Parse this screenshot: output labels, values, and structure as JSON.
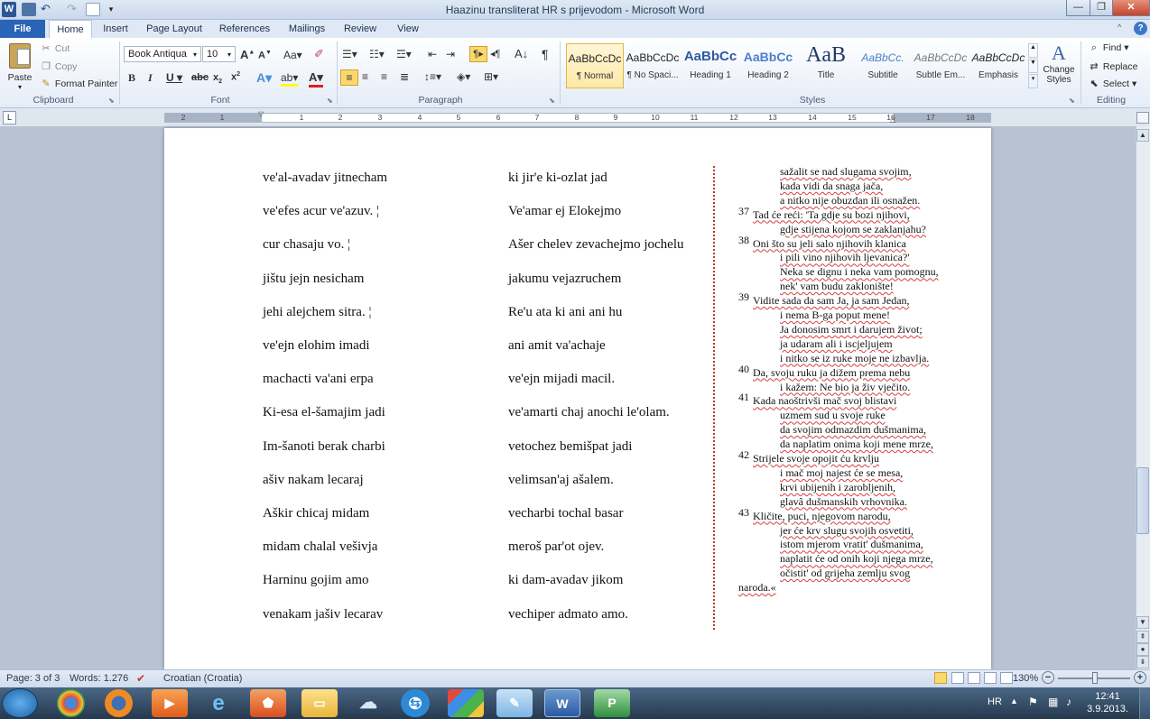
{
  "window": {
    "title": "Haazinu transliterat HR s prijevodom  -  Microsoft Word"
  },
  "tabs": [
    "File",
    "Home",
    "Insert",
    "Page Layout",
    "References",
    "Mailings",
    "Review",
    "View"
  ],
  "clipboard": {
    "paste": "Paste",
    "cut": "Cut",
    "copy": "Copy",
    "format_painter": "Format Painter",
    "label": "Clipboard"
  },
  "font": {
    "name": "Book Antiqua",
    "size": "10",
    "label": "Font"
  },
  "paragraph": {
    "label": "Paragraph"
  },
  "styles": {
    "label": "Styles",
    "items": [
      {
        "sample": "AaBbCcDc",
        "name": "¶ Normal"
      },
      {
        "sample": "AaBbCcDc",
        "name": "¶ No Spaci..."
      },
      {
        "sample": "AaBbCc",
        "name": "Heading 1"
      },
      {
        "sample": "AaBbCc",
        "name": "Heading 2"
      },
      {
        "sample": "AaB",
        "name": "Title"
      },
      {
        "sample": "AaBbCc.",
        "name": "Subtitle"
      },
      {
        "sample": "AaBbCcDc",
        "name": "Subtle Em..."
      },
      {
        "sample": "AaBbCcDc",
        "name": "Emphasis"
      }
    ],
    "change_styles": "Change Styles"
  },
  "editing": {
    "find": "Find",
    "replace": "Replace",
    "select": "Select",
    "label": "Editing"
  },
  "ruler": {
    "numbers": [
      "2",
      "1",
      "1",
      "2",
      "3",
      "4",
      "5",
      "6",
      "7",
      "8",
      "9",
      "10",
      "11",
      "12",
      "13",
      "14",
      "15",
      "16",
      "17",
      "18"
    ]
  },
  "translit": {
    "col1": [
      "ve'al-avadav jitnecham",
      "ve'efes acur ve'azuv. ¦",
      "cur chasaju vo. ¦",
      "jištu jejn nesicham",
      "jehi alejchem sitra. ¦",
      "ve'ejn elohim imadi",
      "machacti va'ani erpa",
      "Ki-esa el-šamajim jadi",
      "Im-šanoti berak charbi",
      "ašiv nakam lecaraj",
      "Aškir chicaj midam",
      "midam chalal vešivja",
      "Harninu gojim amo",
      "venakam jašiv lecarav"
    ],
    "col2": [
      "ki jir'e ki-ozlat jad",
      "Ve'amar ej Elokejmo",
      "Ašer chelev zevachejmo jochelu",
      "jakumu vejazruchem",
      "Re'u ata ki ani ani hu",
      "ani amit va'achaje",
      "ve'ejn mijadi macil.",
      "ve'amarti chaj anochi le'olam.",
      "vetochez bemišpat jadi",
      "velimsan'aj ašalem.",
      "vecharbi tochal basar",
      "meroš par'ot ojev.",
      "ki dam-avadav jikom",
      "vechiper admato amo."
    ]
  },
  "translation": [
    {
      "num": "",
      "text": "sažalit se nad slugama svojim,",
      "indent": true
    },
    {
      "num": "",
      "text": "kada vidi da snaga jača,",
      "indent": true
    },
    {
      "num": "",
      "text": "a nitko nije obuzdan ili osnažen.",
      "indent": true
    },
    {
      "num": "37",
      "text": "Tad će reći: 'Ta gdje su bozi njihovi,",
      "indent": false
    },
    {
      "num": "",
      "text": "gdje stijena kojom se zaklanjahu?",
      "indent": true
    },
    {
      "num": "38",
      "text": "Oni što su jeli salo njihovih klanica",
      "indent": false
    },
    {
      "num": "",
      "text": "i pili vino njihovih ljevanica?'",
      "indent": true
    },
    {
      "num": "",
      "text": "Neka se dignu i neka vam pomognu,",
      "indent": true
    },
    {
      "num": "",
      "text": "nek' vam budu zaklonište!",
      "indent": true
    },
    {
      "num": "39",
      "text": "Vidite sada da sam Ja, ja sam Jedan,",
      "indent": false
    },
    {
      "num": "",
      "text": "i nema B-ga poput mene!",
      "indent": true
    },
    {
      "num": "",
      "text": "Ja donosim smrt i darujem život;",
      "indent": true
    },
    {
      "num": "",
      "text": "ja udaram ali i iscjeljujem",
      "indent": true
    },
    {
      "num": "",
      "text": "i nitko se iz ruke moje ne izbavlja.",
      "indent": true
    },
    {
      "num": "40",
      "text": "Da, svoju ruku ja dižem prema nebu",
      "indent": false
    },
    {
      "num": "",
      "text": "i kažem: Ne bio ja živ vječito.",
      "indent": true
    },
    {
      "num": "41",
      "text": "Kada naoštrivši mač svoj blistavi",
      "indent": false
    },
    {
      "num": "",
      "text": "uzmem sud u svoje ruke",
      "indent": true
    },
    {
      "num": "",
      "text": "da svojim odmazdim dušmanima,",
      "indent": true
    },
    {
      "num": "",
      "text": "da naplatim onima koji mene mrze,",
      "indent": true
    },
    {
      "num": "42",
      "text": "Strijele svoje opojit ću krvlju",
      "indent": false
    },
    {
      "num": "",
      "text": "i mač moj najest će se mesa,",
      "indent": true
    },
    {
      "num": "",
      "text": "krvi ubijenih i zarobljenih,",
      "indent": true
    },
    {
      "num": "",
      "text": "glavâ dušmanskih vrhovnika.",
      "indent": true
    },
    {
      "num": "43",
      "text": "Kličite, puci, njegovom narodu,",
      "indent": false
    },
    {
      "num": "",
      "text": "jer će krv slugu svojih osvetiti,",
      "indent": true
    },
    {
      "num": "",
      "text": "istom mjerom vratit' dušmanima,",
      "indent": true
    },
    {
      "num": "",
      "text": "naplatit će od onih koji njega mrze,",
      "indent": true
    },
    {
      "num": "",
      "text": "očistit' od grijeha zemlju svog",
      "indent": true
    },
    {
      "num": "",
      "text": "naroda.«",
      "indent": false
    }
  ],
  "status": {
    "page": "Page: 3 of 3",
    "words": "Words: 1.276",
    "language": "Croatian (Croatia)",
    "zoom": "130%"
  },
  "taskbar": {
    "lang": "HR",
    "time": "12:41",
    "date": "3.9.2013."
  }
}
